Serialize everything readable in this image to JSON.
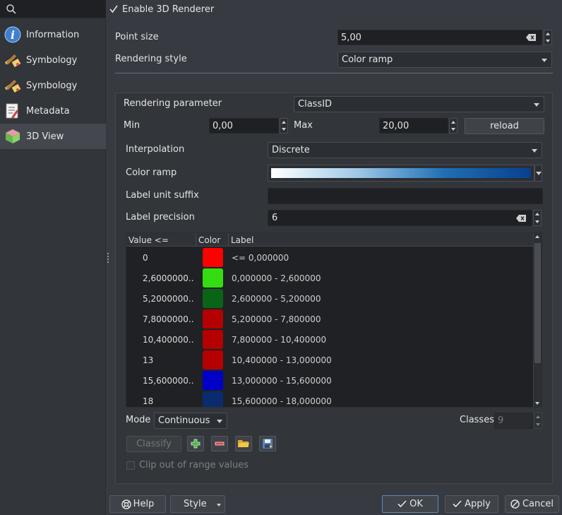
{
  "sidebar": {
    "search_placeholder": "",
    "items": [
      {
        "label": "Information",
        "icon": "info-icon"
      },
      {
        "label": "Symbology",
        "icon": "paintbrush-icon"
      },
      {
        "label": "Symbology",
        "icon": "paintbrush-icon"
      },
      {
        "label": "Metadata",
        "icon": "metadata-icon"
      },
      {
        "label": "3D View",
        "icon": "cube-3d-icon",
        "active": true
      }
    ]
  },
  "renderer": {
    "enable_label": "Enable 3D Renderer",
    "enabled": true,
    "point_size_label": "Point size",
    "point_size_value": "5,00",
    "rendering_style_label": "Rendering style",
    "rendering_style_value": "Color ramp"
  },
  "ramp": {
    "parameter_label": "Rendering parameter",
    "parameter_value": "ClassID",
    "min_label": "Min",
    "min_value": "0,00",
    "max_label": "Max",
    "max_value": "20,00",
    "reload_label": "reload",
    "interpolation_label": "Interpolation",
    "interpolation_value": "Discrete",
    "color_ramp_label": "Color ramp",
    "ramp_colors": [
      "#ffffff",
      "#9ec8e6",
      "#1f6fb4",
      "#08408e"
    ],
    "label_unit_suffix_label": "Label unit suffix",
    "label_unit_suffix_value": "",
    "label_precision_label": "Label precision",
    "label_precision_value": "6"
  },
  "table": {
    "headers": [
      "Value <=",
      "Color",
      "Label"
    ],
    "rows": [
      {
        "value": "0",
        "color": "#ff0000",
        "label": "<= 0,000000"
      },
      {
        "value": "2,6000000...",
        "color": "#33dd11",
        "label": "0,000000 - 2,600000"
      },
      {
        "value": "5,2000000...",
        "color": "#0a6418",
        "label": "2,600000 - 5,200000"
      },
      {
        "value": "7,8000000...",
        "color": "#b40000",
        "label": "5,200000 - 7,800000"
      },
      {
        "value": "10,400000...",
        "color": "#b40000",
        "label": "7,800000 - 10,400000"
      },
      {
        "value": "13",
        "color": "#b40000",
        "label": "10,400000 - 13,000000"
      },
      {
        "value": "15,600000...",
        "color": "#0000c8",
        "label": "13,000000 - 15,600000"
      },
      {
        "value": "18",
        "color": "#0a2c6e",
        "label": "15,600000 - 18,000000"
      }
    ]
  },
  "classify": {
    "mode_label": "Mode",
    "mode_value": "Continuous",
    "classes_label": "Classes",
    "classes_value": "9",
    "classify_label": "Classify",
    "clip_label": "Clip out of range values"
  },
  "footer": {
    "help_label": "Help",
    "style_label": "Style",
    "ok_label": "OK",
    "apply_label": "Apply",
    "cancel_label": "Cancel"
  }
}
